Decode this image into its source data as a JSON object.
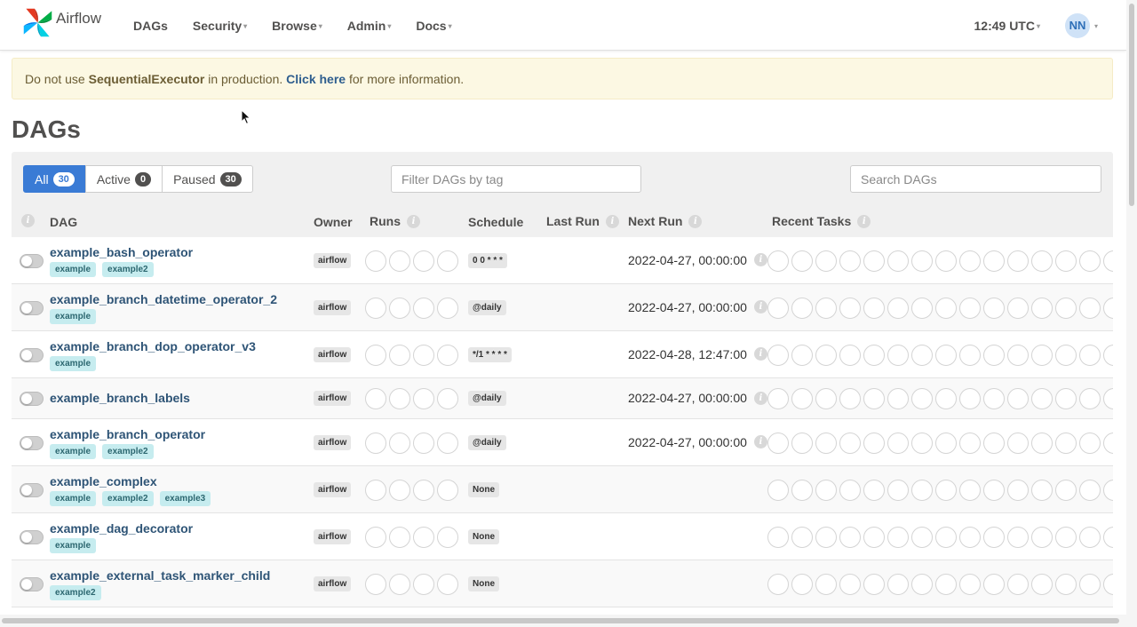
{
  "brand": {
    "name": "Airflow"
  },
  "nav": {
    "items": [
      {
        "label": "DAGs",
        "dropdown": false
      },
      {
        "label": "Security",
        "dropdown": true
      },
      {
        "label": "Browse",
        "dropdown": true
      },
      {
        "label": "Admin",
        "dropdown": true
      },
      {
        "label": "Docs",
        "dropdown": true
      }
    ],
    "time": "12:49 UTC",
    "user_initials": "NN",
    "caret": "▾"
  },
  "alert": {
    "prefix": "Do not use ",
    "executor": "SequentialExecutor",
    "middle": " in production. ",
    "link": "Click here",
    "suffix": " for more information."
  },
  "page_title": "DAGs",
  "filters": {
    "tabs": [
      {
        "label": "All",
        "count": "30",
        "active": true
      },
      {
        "label": "Active",
        "count": "0",
        "active": false
      },
      {
        "label": "Paused",
        "count": "30",
        "active": false
      }
    ],
    "tag_placeholder": "Filter DAGs by tag",
    "search_placeholder": "Search DAGs"
  },
  "table": {
    "headers": {
      "dag": "DAG",
      "owner": "Owner",
      "runs": "Runs",
      "schedule": "Schedule",
      "last_run": "Last Run",
      "next_run": "Next Run",
      "recent_tasks": "Recent Tasks"
    },
    "info_glyph": "i",
    "rows": [
      {
        "name": "example_bash_operator",
        "tags": [
          "example",
          "example2"
        ],
        "owner": "airflow",
        "schedule": "0 0 * * *",
        "next_run": "2022-04-27, 00:00:00"
      },
      {
        "name": "example_branch_datetime_operator_2",
        "tags": [
          "example"
        ],
        "owner": "airflow",
        "schedule": "@daily",
        "next_run": "2022-04-27, 00:00:00"
      },
      {
        "name": "example_branch_dop_operator_v3",
        "tags": [
          "example"
        ],
        "owner": "airflow",
        "schedule": "*/1 * * * *",
        "next_run": "2022-04-28, 12:47:00"
      },
      {
        "name": "example_branch_labels",
        "tags": [],
        "owner": "airflow",
        "schedule": "@daily",
        "next_run": "2022-04-27, 00:00:00"
      },
      {
        "name": "example_branch_operator",
        "tags": [
          "example",
          "example2"
        ],
        "owner": "airflow",
        "schedule": "@daily",
        "next_run": "2022-04-27, 00:00:00"
      },
      {
        "name": "example_complex",
        "tags": [
          "example",
          "example2",
          "example3"
        ],
        "owner": "airflow",
        "schedule": "None",
        "next_run": ""
      },
      {
        "name": "example_dag_decorator",
        "tags": [
          "example"
        ],
        "owner": "airflow",
        "schedule": "None",
        "next_run": ""
      },
      {
        "name": "example_external_task_marker_child",
        "tags": [
          "example2"
        ],
        "owner": "airflow",
        "schedule": "None",
        "next_run": ""
      }
    ]
  },
  "colors": {
    "accent": "#3a7bd5",
    "dag_link": "#2e5476",
    "tag_bg": "#c6ecef",
    "alert_bg": "#fcf8e3"
  }
}
